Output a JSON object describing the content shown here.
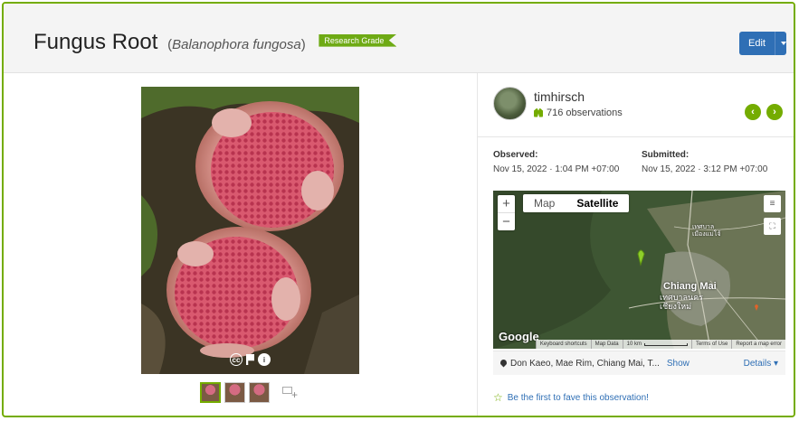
{
  "header": {
    "common_name": "Fungus Root",
    "scientific_name": "Balanophora fungosa",
    "grade_badge": "Research Grade",
    "edit_label": "Edit"
  },
  "photo": {
    "license_icons": [
      "cc-icon",
      "flag-icon",
      "info-icon"
    ],
    "thumbnail_count": 3
  },
  "observer": {
    "username": "timhirsch",
    "observations": "716 observations"
  },
  "dates": {
    "observed_label": "Observed:",
    "observed_value": "Nov 15, 2022 · 1:04 PM +07:00",
    "submitted_label": "Submitted:",
    "submitted_value": "Nov 15, 2022 · 3:12 PM +07:00"
  },
  "map": {
    "type_map": "Map",
    "type_satellite": "Satellite",
    "selected_type": "Satellite",
    "zoom_in": "+",
    "zoom_out": "−",
    "city_label": "Chiang Mai",
    "city_thai": "เทศบาลนคร\nเชียงใหม่",
    "small_thai": "เทศบาล\nเมืองแม่โจ้",
    "google_logo": "Google",
    "keyboard_shortcuts": "Keyboard shortcuts",
    "map_data": "Map Data",
    "scale": "10 km",
    "terms": "Terms of Use",
    "report": "Report a map error"
  },
  "place": {
    "text": "Don Kaeo, Mae Rim, Chiang Mai, T...",
    "show": "Show",
    "details": "Details ▾"
  },
  "fave": {
    "text": "Be the first to fave this observation!"
  },
  "colors": {
    "accent_green": "#74ac00",
    "edit_blue": "#2f6fb5"
  }
}
